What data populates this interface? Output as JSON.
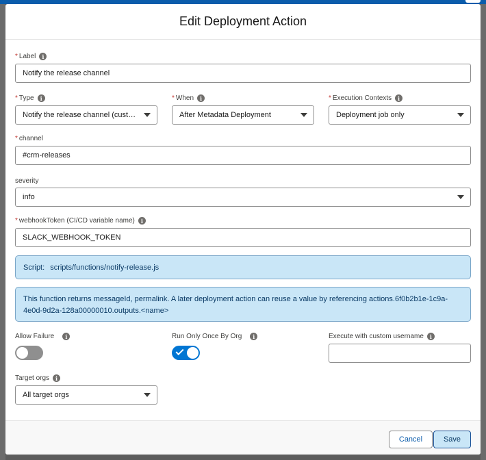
{
  "modal": {
    "title": "Edit Deployment Action"
  },
  "fields": {
    "label": {
      "label": "Label",
      "value": "Notify the release channel"
    },
    "type": {
      "label": "Type",
      "value": "Notify the release channel (custom)"
    },
    "when": {
      "label": "When",
      "value": "After Metadata Deployment"
    },
    "execution_contexts": {
      "label": "Execution Contexts",
      "value": "Deployment job only"
    },
    "channel": {
      "label": "channel",
      "value": "#crm-releases"
    },
    "severity": {
      "label": "severity",
      "value": "info"
    },
    "webhook_token": {
      "label": "webhookToken (CI/CD variable name)",
      "value": "SLACK_WEBHOOK_TOKEN"
    },
    "allow_failure": {
      "label": "Allow Failure",
      "checked": false
    },
    "run_only_once": {
      "label": "Run Only Once By Org",
      "checked": true
    },
    "custom_username": {
      "label": "Execute with custom username",
      "value": ""
    },
    "target_orgs": {
      "label": "Target orgs",
      "value": "All target orgs"
    }
  },
  "required_mark": "*",
  "script_banner": {
    "label": "Script:",
    "path": "scripts/functions/notify-release.js"
  },
  "info_banner": {
    "line1": "This function returns messageId, permalink. A later deployment action can reuse a value by referencing actions.6f0b2b1e-1c9a-",
    "line2": "4e0d-9d2a-128a00000010.outputs.<name>"
  },
  "footer": {
    "cancel_label": "Cancel",
    "save_label": "Save"
  },
  "colors": {
    "brand": "#0b5cab",
    "toggle_on": "#0176d3",
    "banner_bg": "#c9e6f7",
    "required": "#c23934"
  },
  "icons": {
    "info": "info-icon",
    "caret": "chevron-down-icon",
    "check": "check-icon"
  }
}
